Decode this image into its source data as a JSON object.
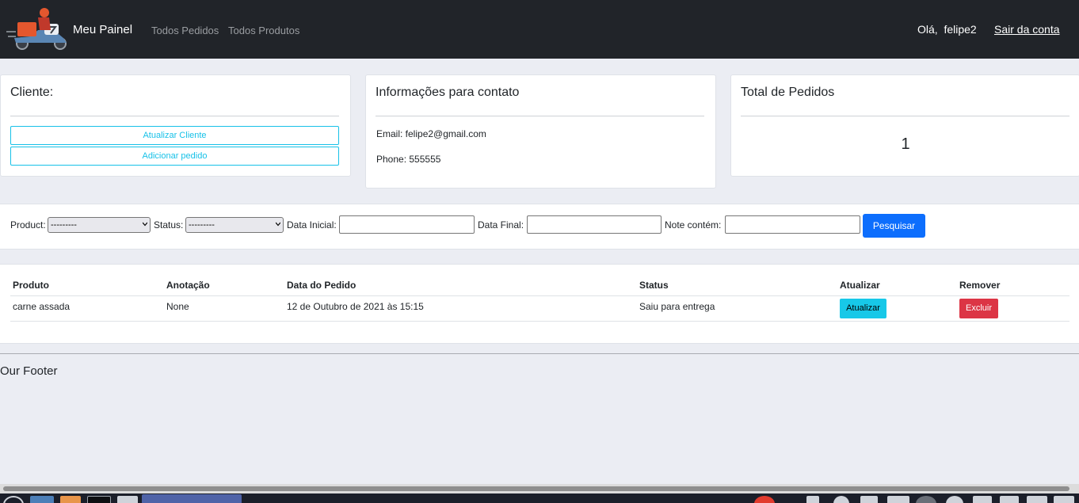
{
  "navbar": {
    "brand": "Meu Painel",
    "links": [
      "Todos Pedidos",
      "Todos Produtos"
    ],
    "greeting": "Olá,  felipe2",
    "logout": "Sair da conta",
    "logo_icon": "delivery-scooter-icon",
    "bg_color": "#212429"
  },
  "customer_card": {
    "title": "Cliente:",
    "update_button": "Atualizar Cliente",
    "add_order_button": "Adicionar pedido",
    "accent": "#17c1e8"
  },
  "contact_card": {
    "title": "Informações para contato",
    "email": "Email: felipe2@gmail.com",
    "phone": "Phone: 555555"
  },
  "orders_total_card": {
    "title": "Total de Pedidos",
    "count": "1"
  },
  "filter": {
    "product_label": "Product:",
    "product_value": "---------",
    "status_label": "Status:",
    "status_value": "---------",
    "start_date_label": "Data Inicial:",
    "start_date_value": "",
    "end_date_label": "Data Final:",
    "end_date_value": "",
    "note_label": "Note contém:",
    "note_value": "",
    "search_button": "Pesquisar",
    "primary_color": "#0d6efd"
  },
  "orders_table": {
    "headers": [
      "Produto",
      "Anotação",
      "Data do Pedido",
      "Status",
      "Atualizar",
      "Remover"
    ],
    "rows": [
      {
        "product": "carne assada",
        "note": "None",
        "date": "12 de Outubro de 2021 às 15:15",
        "status": "Saiu para entrega",
        "update_button": "Atualizar",
        "delete_button": "Excluir"
      }
    ],
    "danger_color": "#dc3545",
    "info_color": "#17c8e8"
  },
  "footer": {
    "text": "Our Footer"
  }
}
